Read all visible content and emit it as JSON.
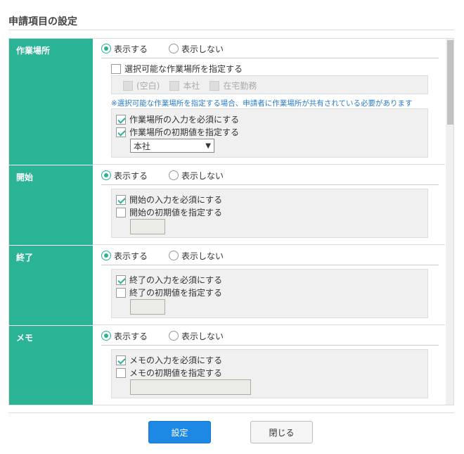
{
  "title": "申請項目の設定",
  "radio_show": "表示する",
  "radio_hide": "表示しない",
  "rows": [
    {
      "label": "作業場所",
      "specify_label": "選択可能な作業場所を指定する",
      "options": [
        "(空白)",
        "本社",
        "在宅勤務"
      ],
      "note": "※選択可能な作業場所を指定する場合、申請者に作業場所が共有されている必要があります",
      "required_label": "作業場所の入力を必須にする",
      "default_label": "作業場所の初期値を指定する",
      "default_value": "本社"
    },
    {
      "label": "開始",
      "required_label": "開始の入力を必須にする",
      "default_label": "開始の初期値を指定する"
    },
    {
      "label": "終了",
      "required_label": "終了の入力を必須にする",
      "default_label": "終了の初期値を指定する"
    },
    {
      "label": "メモ",
      "required_label": "メモの入力を必須にする",
      "default_label": "メモの初期値を指定する"
    }
  ],
  "buttons": {
    "save": "設定",
    "close": "閉じる"
  }
}
